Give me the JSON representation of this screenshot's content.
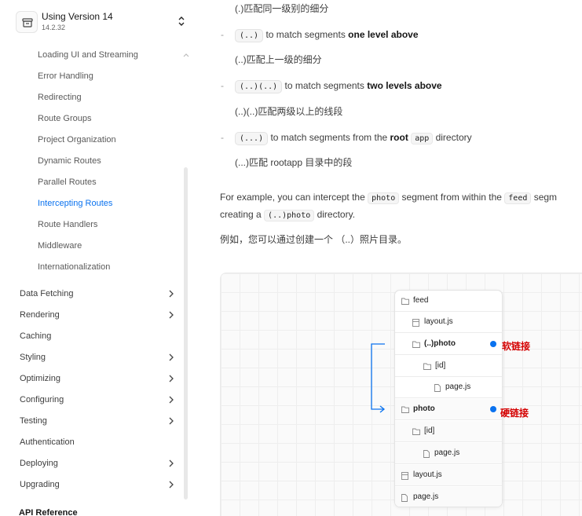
{
  "sidebar": {
    "version_title": "Using Version 14",
    "version_number": "14.2.32",
    "sub_items": [
      {
        "label": "Loading UI and Streaming",
        "active": false
      },
      {
        "label": "Error Handling",
        "active": false
      },
      {
        "label": "Redirecting",
        "active": false
      },
      {
        "label": "Route Groups",
        "active": false
      },
      {
        "label": "Project Organization",
        "active": false
      },
      {
        "label": "Dynamic Routes",
        "active": false
      },
      {
        "label": "Parallel Routes",
        "active": false
      },
      {
        "label": "Intercepting Routes",
        "active": true
      },
      {
        "label": "Route Handlers",
        "active": false
      },
      {
        "label": "Middleware",
        "active": false
      },
      {
        "label": "Internationalization",
        "active": false
      }
    ],
    "top_items": [
      {
        "label": "Data Fetching",
        "has_chevron": true
      },
      {
        "label": "Rendering",
        "has_chevron": true
      },
      {
        "label": "Caching",
        "has_chevron": false
      },
      {
        "label": "Styling",
        "has_chevron": true
      },
      {
        "label": "Optimizing",
        "has_chevron": true
      },
      {
        "label": "Configuring",
        "has_chevron": true
      },
      {
        "label": "Testing",
        "has_chevron": true
      },
      {
        "label": "Authentication",
        "has_chevron": false
      },
      {
        "label": "Deploying",
        "has_chevron": true
      },
      {
        "label": "Upgrading",
        "has_chevron": true
      }
    ],
    "api_reference": "API Reference",
    "accent_color": "#0a72ef"
  },
  "content": {
    "zh_line_0": "(.)匹配同一级别的细分",
    "bullets": [
      {
        "code": "(..)",
        "before": "to match segments ",
        "bold": "one level above",
        "after": "",
        "zh": "(..)匹配上一级的细分"
      },
      {
        "code": "(..)(..)",
        "before": "to match segments ",
        "bold": "two levels above",
        "after": "",
        "zh": "(..)(..)匹配两级以上的线段"
      },
      {
        "code": "(...)",
        "before": "to match segments from the ",
        "bold": "root",
        "code2": "app",
        "after": "directory",
        "zh": "(...)匹配 rootapp 目录中的段"
      }
    ],
    "example": {
      "p1_a": "For example, you can intercept the ",
      "p1_code1": "photo",
      "p1_b": " segment from within the ",
      "p1_code2": "feed",
      "p1_c": " segm",
      "p2_a": "creating a ",
      "p2_code": "(..)photo",
      "p2_b": " directory.",
      "zh": "例如，您可以通过创建一个 （..）照片目录。"
    }
  },
  "diagram": {
    "rows": [
      {
        "label": "feed",
        "icon": "folder-icon",
        "bold": false
      },
      {
        "label": "layout.js",
        "icon": "layout-file-icon",
        "bold": false
      },
      {
        "label": "(..)photo",
        "icon": "folder-icon",
        "bold": true
      },
      {
        "label": "[id]",
        "icon": "folder-icon",
        "bold": false
      },
      {
        "label": "page.js",
        "icon": "file-icon",
        "bold": false
      },
      {
        "label": "photo",
        "icon": "folder-icon",
        "bold": true
      },
      {
        "label": "[id]",
        "icon": "folder-icon",
        "bold": false
      },
      {
        "label": "page.js",
        "icon": "file-icon",
        "bold": false
      },
      {
        "label": "layout.js",
        "icon": "layout-file-icon",
        "bold": false
      },
      {
        "label": "page.js",
        "icon": "file-icon",
        "bold": false
      }
    ],
    "annotation_soft": "软链接",
    "annotation_hard": "硬链接",
    "link_color": "#0a72ef",
    "annotation_color": "#d40000"
  }
}
